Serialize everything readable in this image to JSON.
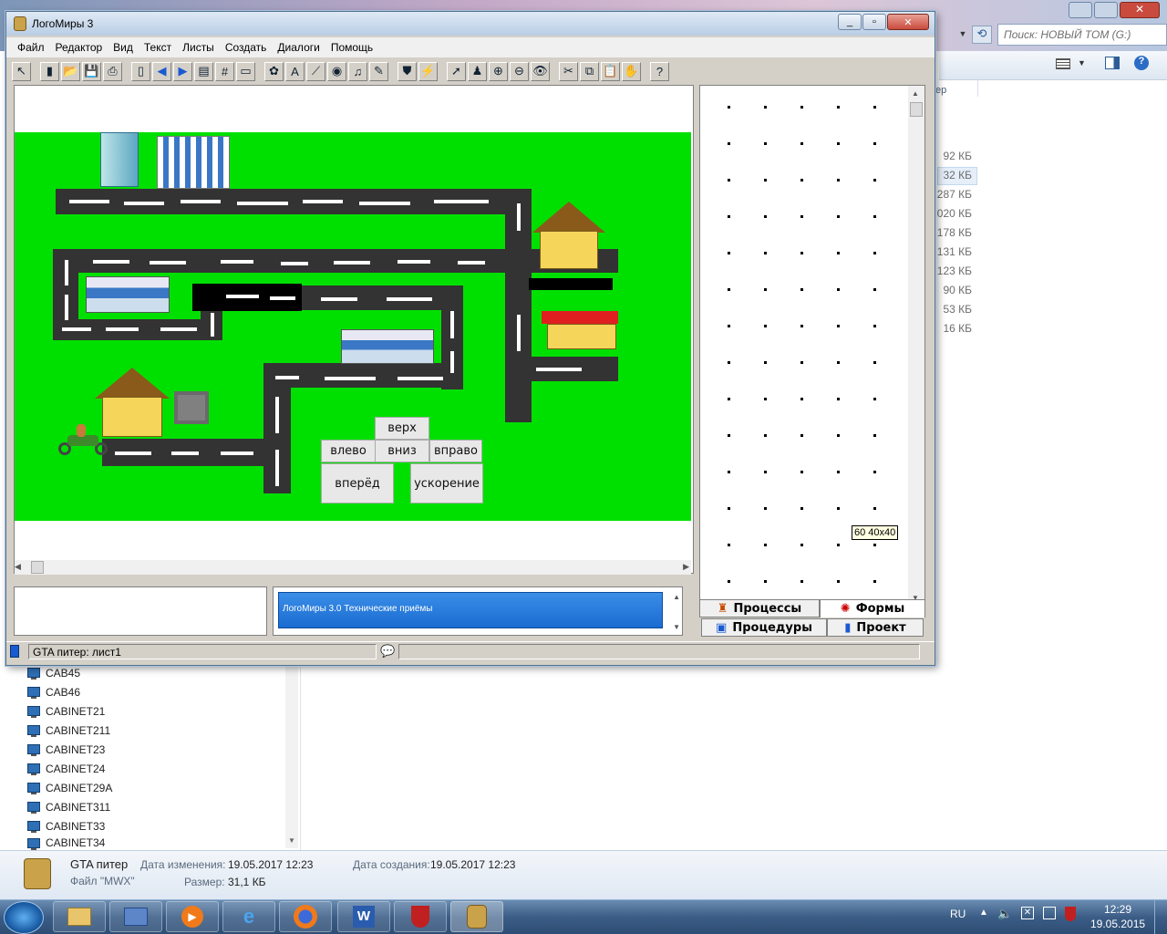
{
  "explorer": {
    "search_placeholder": "Поиск: НОВЫЙ ТОМ (G:)",
    "header_partial": "ер",
    "sizes": [
      "92 КБ",
      "32 КБ",
      "287 КБ",
      "020 КБ",
      "178 КБ",
      "131 КБ",
      "123 КБ",
      "90 КБ",
      "53 КБ",
      "16 КБ"
    ],
    "tree_items": [
      "CAB45",
      "CAB46",
      "CABINET21",
      "CABINET211",
      "CABINET23",
      "CABINET24",
      "CABINET29A",
      "CABINET311",
      "CABINET33",
      "CABINET34"
    ]
  },
  "details": {
    "name": "GTA питер",
    "type": "Файл \"MWX\"",
    "modified_label": "Дата изменения:",
    "modified_value": "19.05.2017 12:23",
    "created_label": "Дата создания:",
    "created_value": "19.05.2017 12:23",
    "size_label": "Размер:",
    "size_value": "31,1 КБ"
  },
  "taskbar": {
    "lang": "RU",
    "time": "12:29",
    "date": "19.05.2015"
  },
  "window": {
    "title": "ЛогоМиры 3",
    "menu": [
      "Файл",
      "Редактор",
      "Вид",
      "Текст",
      "Листы",
      "Создать",
      "Диалоги",
      "Помощь"
    ],
    "game_buttons": {
      "up": "верх",
      "left": "влево",
      "down": "вниз",
      "right": "вправо",
      "forward": "вперёд",
      "accel": "ускорение"
    },
    "tooltip": "60 40x40",
    "tabs": {
      "processes": "Процессы",
      "forms": "Формы",
      "procedures": "Процедуры",
      "project": "Проект"
    },
    "info_text": "ЛогоМиры 3.0 Технические приёмы",
    "status": "GTA питер:  лист1"
  },
  "colors": {
    "field": "#00e000",
    "road": "#333333",
    "info": "#1a6cd0"
  }
}
